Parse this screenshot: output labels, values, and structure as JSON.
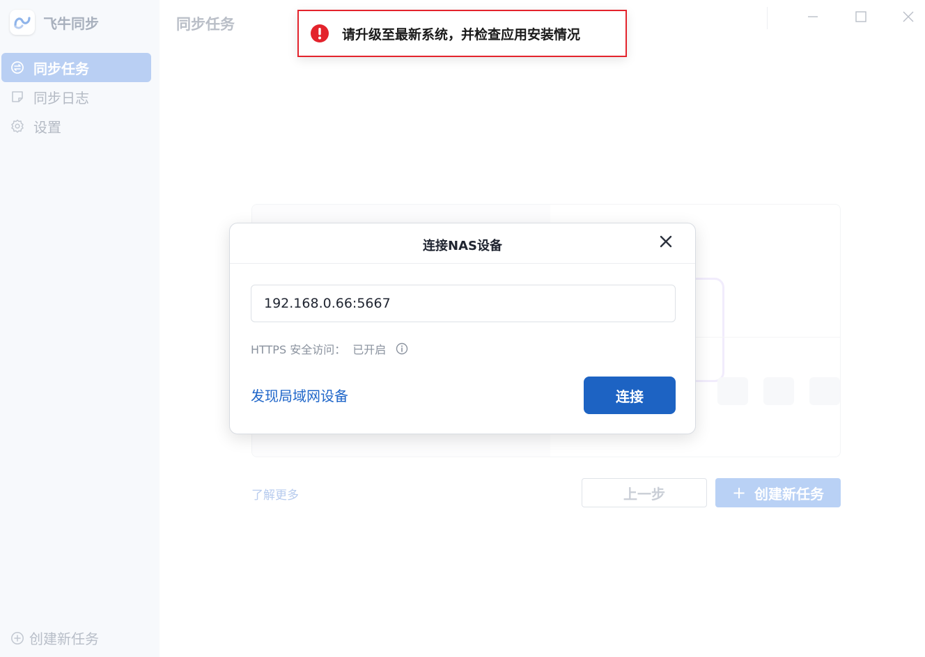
{
  "app": {
    "name": "飞牛同步",
    "logo_icon": "feiniu-logo-icon"
  },
  "sidebar": {
    "items": [
      {
        "label": "同步任务",
        "icon": "sync-task-icon",
        "active": true
      },
      {
        "label": "同步日志",
        "icon": "log-icon",
        "active": false
      },
      {
        "label": "设置",
        "icon": "gear-icon",
        "active": false
      }
    ],
    "create_task": {
      "label": "创建新任务",
      "icon": "plus-circle-icon"
    }
  },
  "header": {
    "title": "同步任务"
  },
  "window_controls": [
    "minimize-icon",
    "maximize-icon",
    "close-icon"
  ],
  "toast": {
    "type": "error",
    "message": "请升级至最新系统，并检查应用安装情况",
    "color": "#e3232c"
  },
  "page": {
    "learn_more": "了解更多",
    "prev_button": "上一步",
    "create_button": "创建新任务"
  },
  "dialog": {
    "title": "连接NAS设备",
    "address_value": "192.168.0.66:5667",
    "https_label": "HTTPS 安全访问：",
    "https_status": "已开启",
    "discover_link": "发现局域网设备",
    "connect_button": "连接"
  },
  "colors": {
    "accent": "#1d63c3",
    "active_nav_bg": "#b9cff3",
    "error": "#e3232c"
  }
}
